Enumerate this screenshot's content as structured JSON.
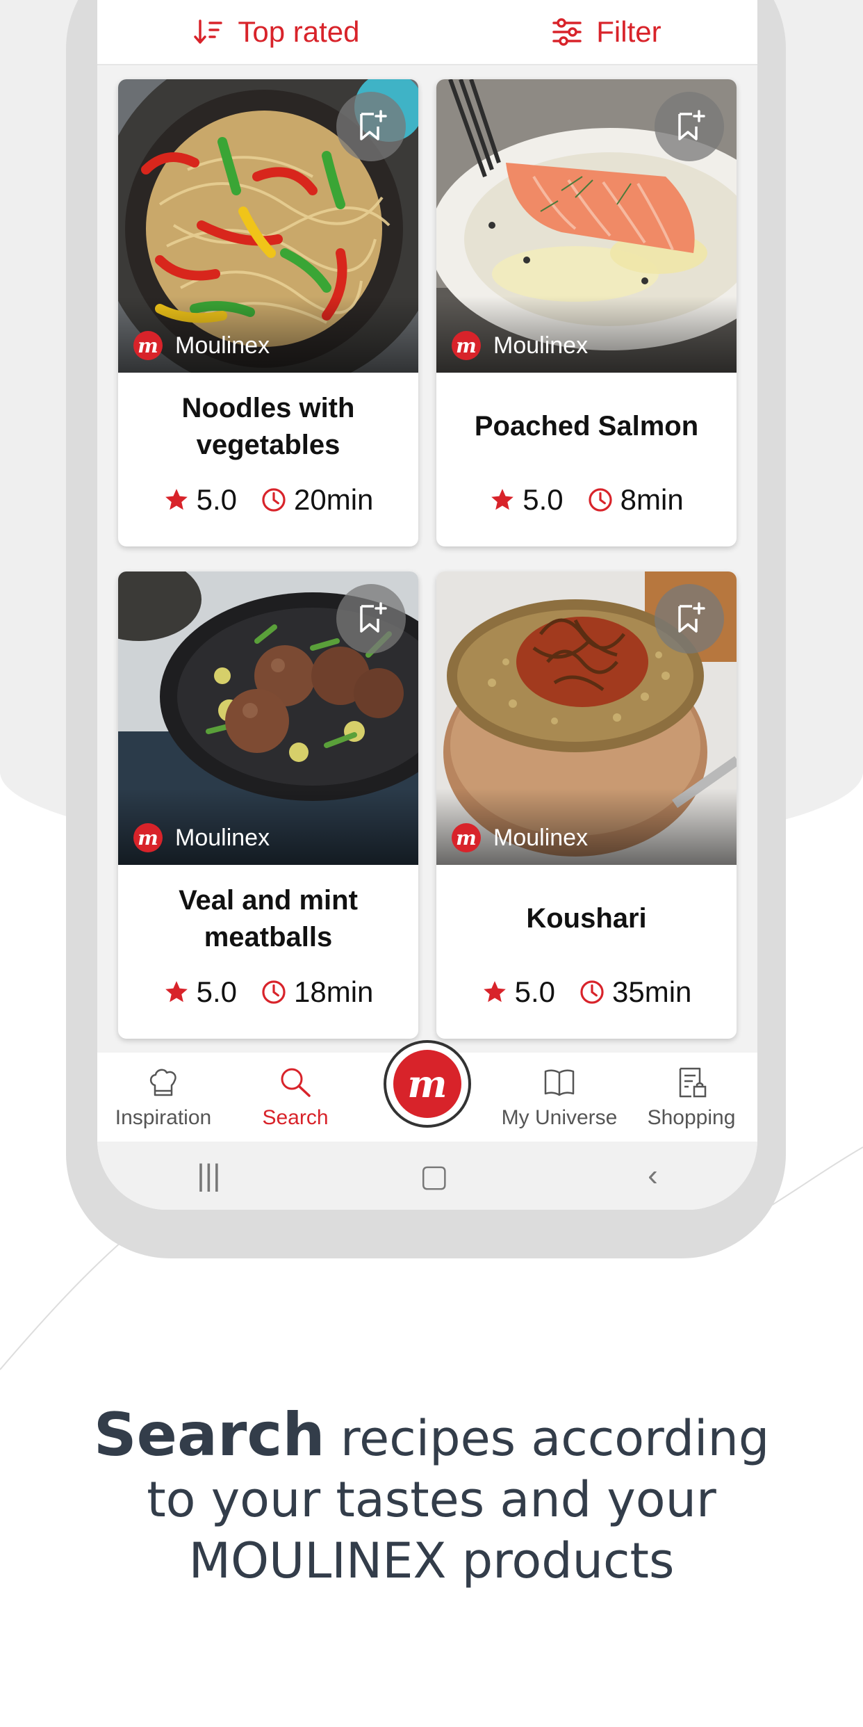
{
  "colors": {
    "accent": "#d8232a",
    "text_dark": "#333d4a",
    "background_gray": "#efefef"
  },
  "sortbar": {
    "sort_label": "Top rated",
    "sort_icon": "sort-descending-icon",
    "filter_label": "Filter",
    "filter_icon": "sliders-icon"
  },
  "recipes": [
    {
      "brand": "Moulinex",
      "title": "Noodles with vegetables",
      "rating": "5.0",
      "time": "20min",
      "image": "noodles-photo"
    },
    {
      "brand": "Moulinex",
      "title": "Poached Salmon",
      "rating": "5.0",
      "time": "8min",
      "image": "salmon-photo"
    },
    {
      "brand": "Moulinex",
      "title": "Veal and mint meatballs",
      "rating": "5.0",
      "time": "18min",
      "image": "meatballs-photo"
    },
    {
      "brand": "Moulinex",
      "title": "Koushari",
      "rating": "5.0",
      "time": "35min",
      "image": "koushari-photo"
    }
  ],
  "bottom_nav": {
    "items": [
      {
        "label": "Inspiration",
        "icon": "chef-hat-icon"
      },
      {
        "label": "Search",
        "icon": "search-icon",
        "active": true
      },
      {
        "label": "My Universe",
        "icon": "book-icon"
      },
      {
        "label": "Shopping",
        "icon": "shopping-list-icon"
      }
    ],
    "center_logo": "m"
  },
  "system_nav": {
    "recent": "|||",
    "home": "▢",
    "back": "‹"
  },
  "caption": {
    "bold": "Search",
    "line1": " recipes according",
    "line2": "to your tastes and your",
    "line3": "MOULINEX products"
  }
}
